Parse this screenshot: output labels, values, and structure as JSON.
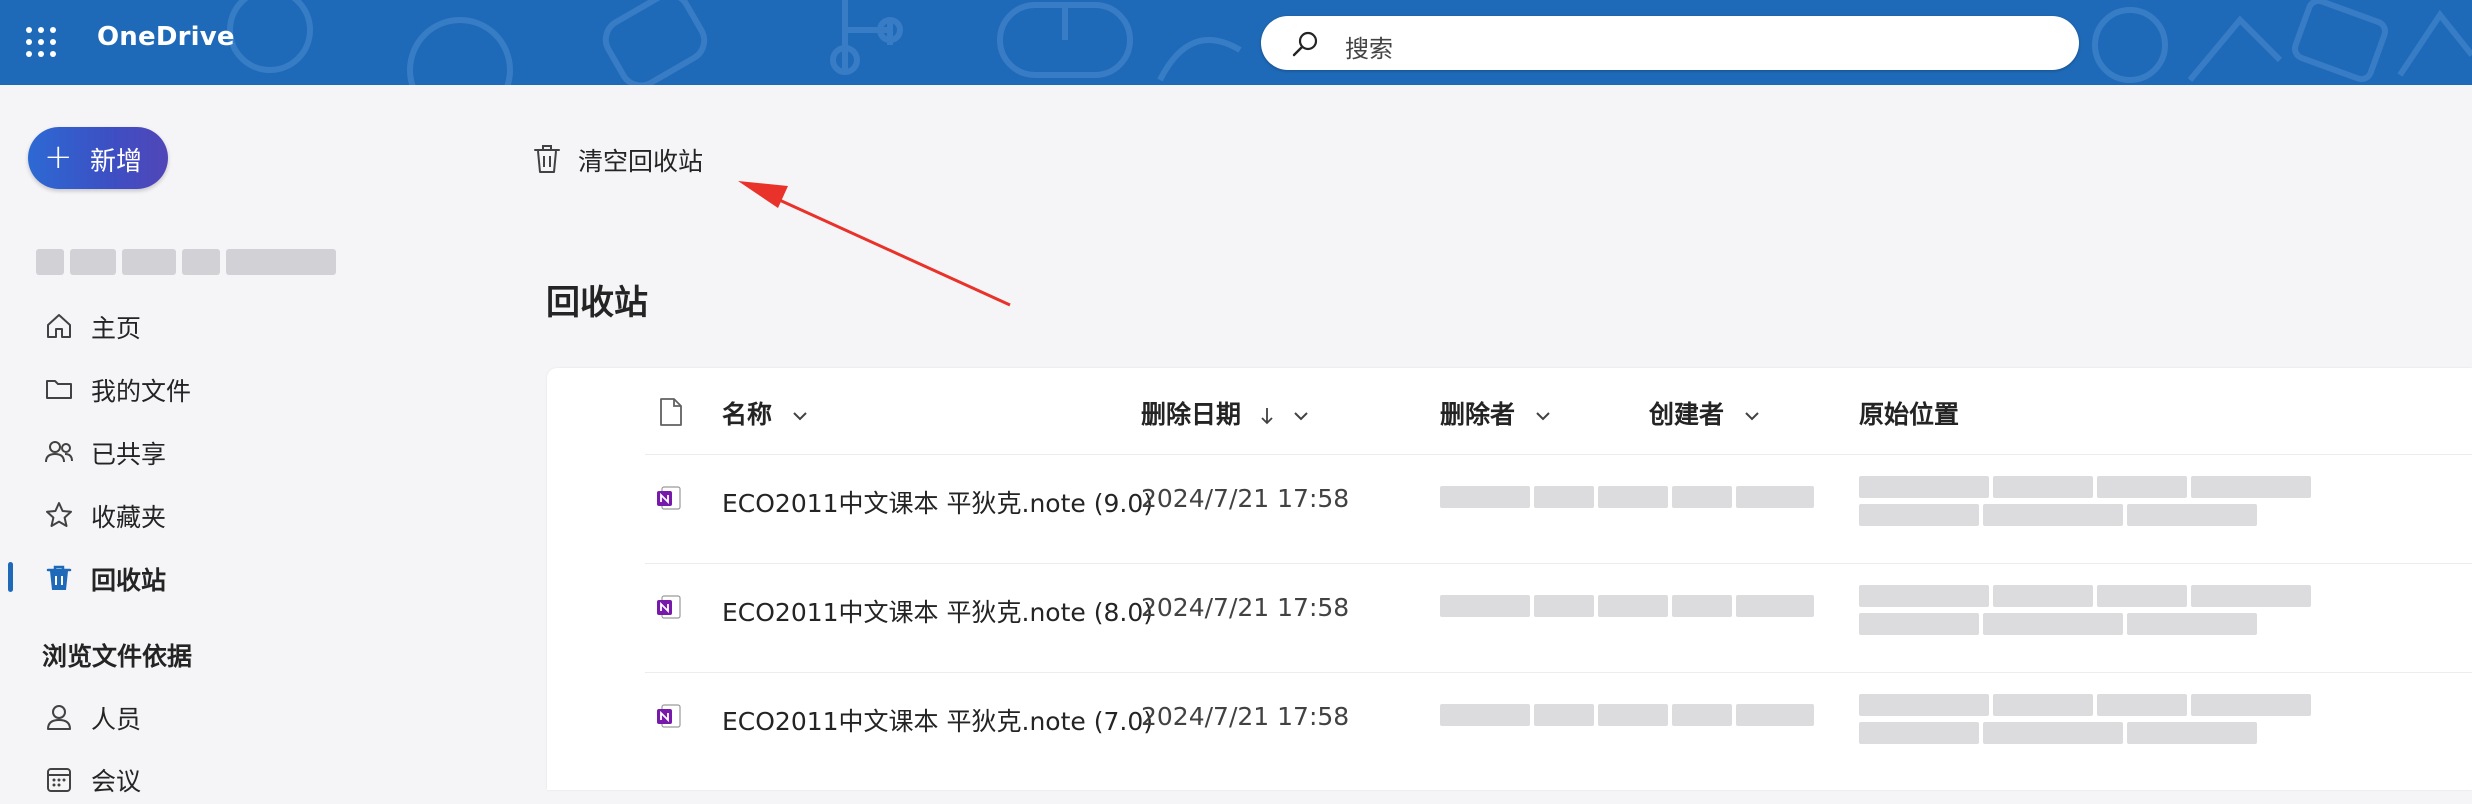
{
  "header": {
    "app_name": "OneDrive",
    "search_placeholder": "搜索"
  },
  "sidebar": {
    "new_button_label": "新增",
    "nav": [
      {
        "label": "主页",
        "icon": "home-icon",
        "active": false
      },
      {
        "label": "我的文件",
        "icon": "folder-icon",
        "active": false
      },
      {
        "label": "已共享",
        "icon": "people-icon",
        "active": false
      },
      {
        "label": "收藏夹",
        "icon": "star-icon",
        "active": false
      },
      {
        "label": "回收站",
        "icon": "recycle-bin-icon",
        "active": true
      }
    ],
    "browse_section_label": "浏览文件依据",
    "browse": [
      {
        "label": "人员",
        "icon": "person-icon"
      },
      {
        "label": "会议",
        "icon": "calendar-icon"
      }
    ]
  },
  "toolbar": {
    "empty_recycle_bin_label": "清空回收站"
  },
  "page_title": "回收站",
  "table": {
    "columns": [
      {
        "label": "名称",
        "sortable": true
      },
      {
        "label": "删除日期",
        "sort": "descending"
      },
      {
        "label": "删除者",
        "sortable": true
      },
      {
        "label": "创建者",
        "sortable": true
      },
      {
        "label": "原始位置",
        "sortable": false
      }
    ],
    "rows": [
      {
        "name": "ECO2011中文课本 平狄克.note (9.0)",
        "deleted_date": "2024/7/21 17:58",
        "icon": "onenote-icon"
      },
      {
        "name": "ECO2011中文课本 平狄克.note (8.0)",
        "deleted_date": "2024/7/21 17:58",
        "icon": "onenote-icon"
      },
      {
        "name": "ECO2011中文课本 平狄克.note (7.0)",
        "deleted_date": "2024/7/21 17:58",
        "icon": "onenote-icon"
      }
    ]
  },
  "colors": {
    "header_bg": "#1f6ab8",
    "accent": "#1f6ab8",
    "annotation_arrow": "#e8322a",
    "onenote_purple": "#7719aa"
  }
}
